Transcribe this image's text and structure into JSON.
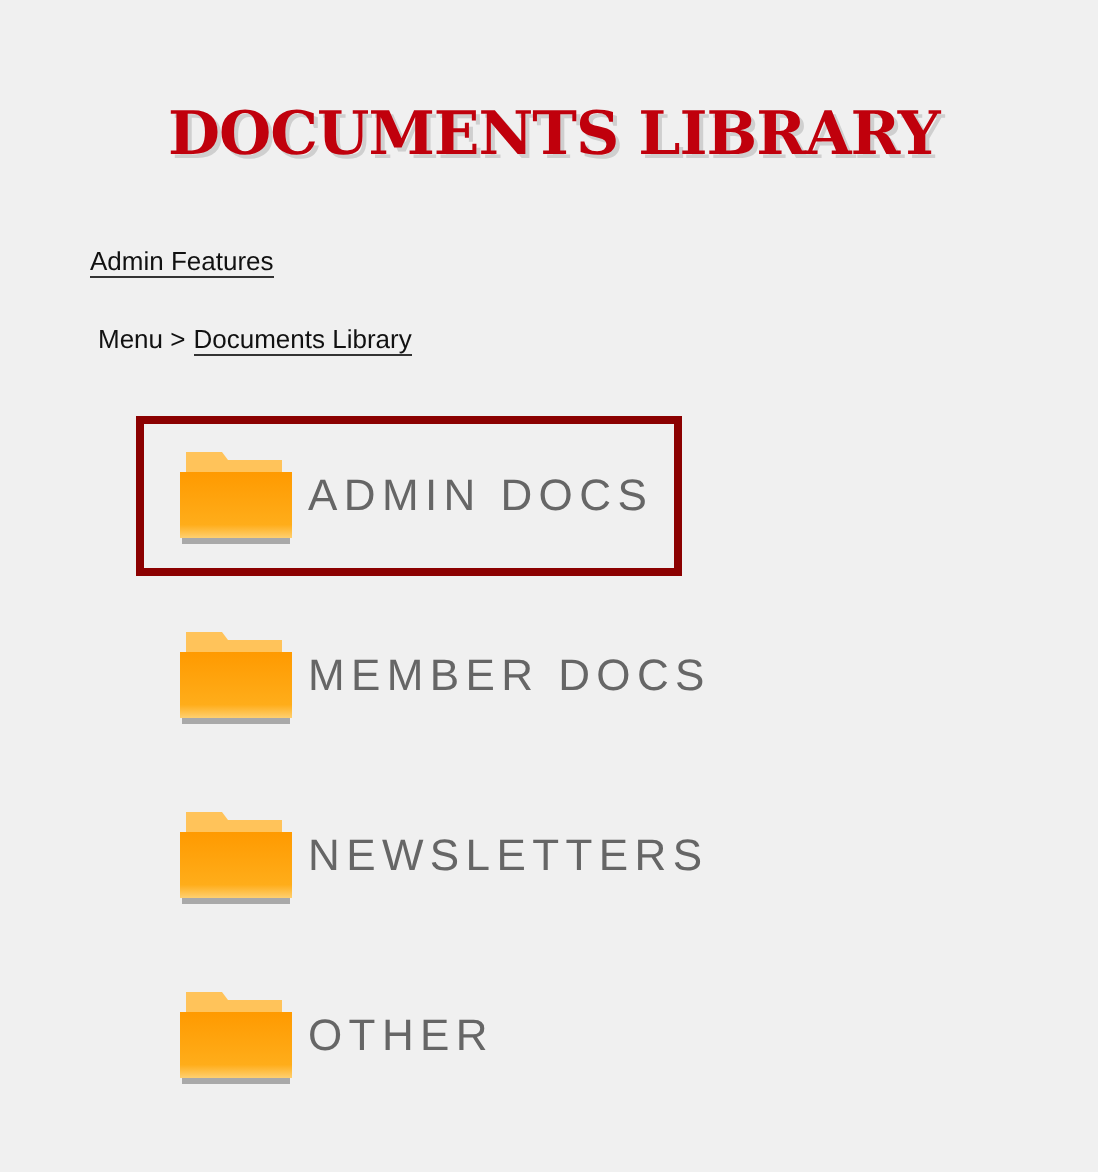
{
  "title": "DOCUMENTS LIBRARY",
  "admin_link": "Admin Features",
  "breadcrumb": {
    "prefix": "Menu >",
    "link": "Documents Library"
  },
  "folders": [
    {
      "label": "ADMIN DOCS",
      "selected": true
    },
    {
      "label": "MEMBER DOCS",
      "selected": false
    },
    {
      "label": "NEWSLETTERS",
      "selected": false
    },
    {
      "label": "OTHER",
      "selected": false
    }
  ]
}
